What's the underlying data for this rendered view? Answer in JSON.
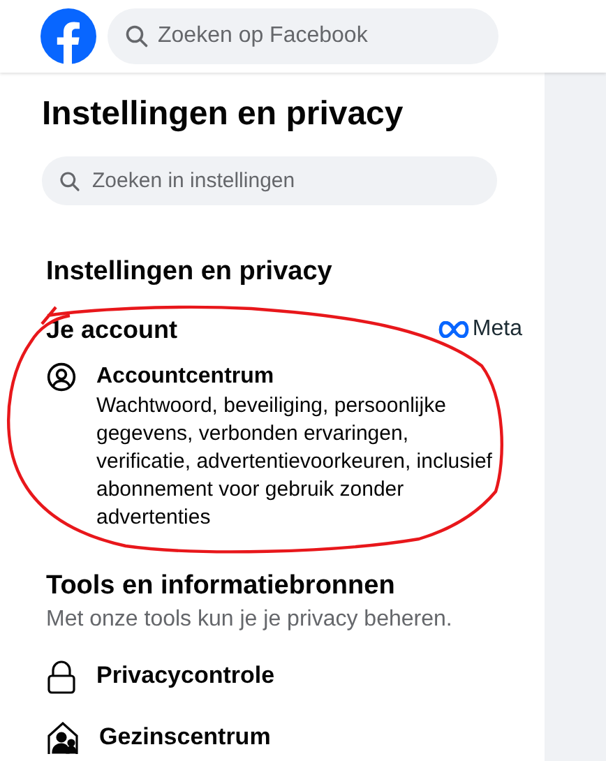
{
  "header": {
    "search": {
      "placeholder": "Zoeken op Facebook"
    }
  },
  "panel": {
    "title": "Instellingen en privacy",
    "search": {
      "placeholder": "Zoeken in instellingen"
    },
    "heading": "Instellingen en privacy",
    "sections": [
      {
        "title": "Je account",
        "brand": "Meta",
        "items": [
          {
            "kind": "account",
            "title": "Accountcentrum",
            "description": "Wachtwoord, beveiliging, persoonlijke gegevens, verbonden ervaringen, verificatie, advertentievoorkeuren, inclusief abonnement voor gebruik zonder advertenties"
          }
        ]
      },
      {
        "title": "Tools en informatiebronnen",
        "subtitle": "Met onze tools kun je je privacy beheren.",
        "items": [
          {
            "kind": "lock",
            "title": "Privacycontrole"
          },
          {
            "kind": "family",
            "title": "Gezinscentrum"
          }
        ]
      }
    ]
  }
}
